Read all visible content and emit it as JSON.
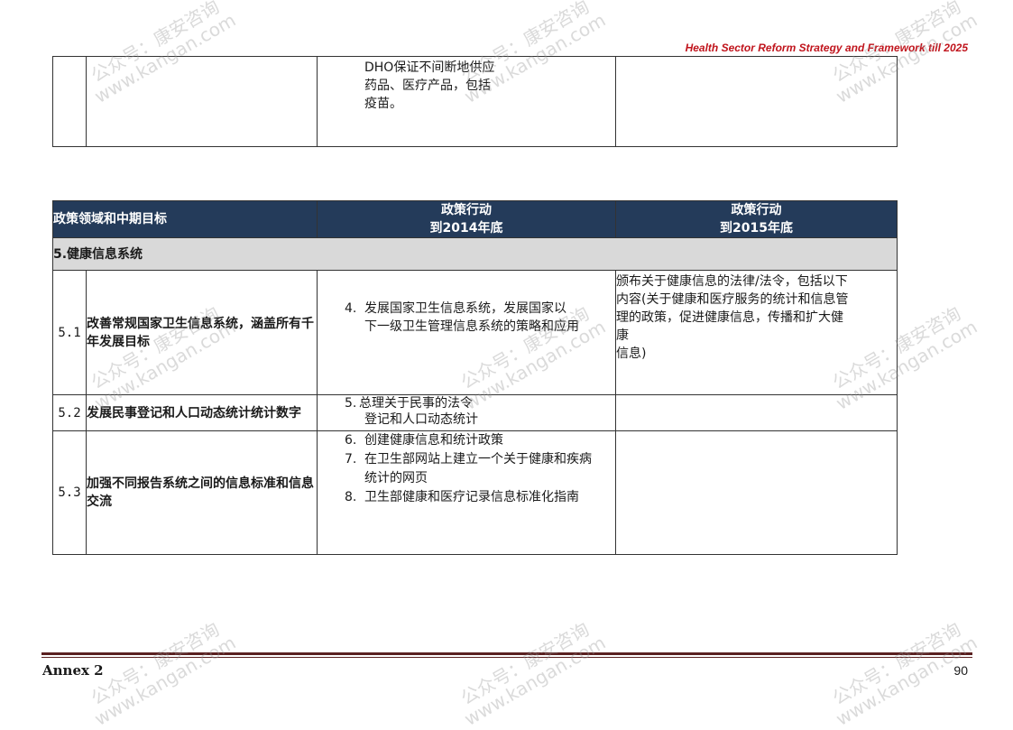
{
  "header": {
    "title": "Health Sector Reform Strategy and Framework till 2025"
  },
  "table_top": {
    "col3_lines": [
      "DHO保证不间断地供应",
      "药品、医疗产品，包括",
      "疫苗。"
    ]
  },
  "table_main": {
    "headers": {
      "col1": "政策领域和中期目标",
      "col2_line1": "政策行动",
      "col2_line2": "到2014年底",
      "col3_line1": "政策行动",
      "col3_line2": "到2015年底"
    },
    "section": "5.健康信息系统",
    "rows": [
      {
        "num": "5.1",
        "goal": "改善常规国家卫生信息系统，涵盖所有千年发展目标",
        "action_num": "4.",
        "action_first": "发展国家卫生信息系统，发展国家以",
        "action_rest": "下一级卫生管理信息系统的策略和应用",
        "col4_lines": [
          "颁布关于健康信息的法律/法令，包括以下",
          "内容(关于健康和医疗服务的统计和信息管",
          "理的政策，促进健康信息，传播和扩大健",
          "康",
          "信息)"
        ]
      },
      {
        "num": "5.2",
        "goal": "发展民事登记和人口动态统计统计数字",
        "action_num": "5.",
        "action_first": "总理关于民事的法令",
        "action_rest": "登记和人口动态统计"
      },
      {
        "num": "5.3",
        "goal": "加强不同报告系统之间的信息标准和信息交流",
        "actions": [
          {
            "n": "6.",
            "text": "创建健康信息和统计政策"
          },
          {
            "n": "7.",
            "text": "在卫生部网站上建立一个关于健康和疾病统计的网页"
          },
          {
            "n": "8.",
            "text": "卫生部健康和医疗记录信息标准化指南"
          }
        ]
      }
    ]
  },
  "footer": {
    "left": "Annex 2",
    "page": "90"
  },
  "watermark": {
    "line1": "公众号：康安咨询",
    "line2": "www.kangan.com"
  }
}
